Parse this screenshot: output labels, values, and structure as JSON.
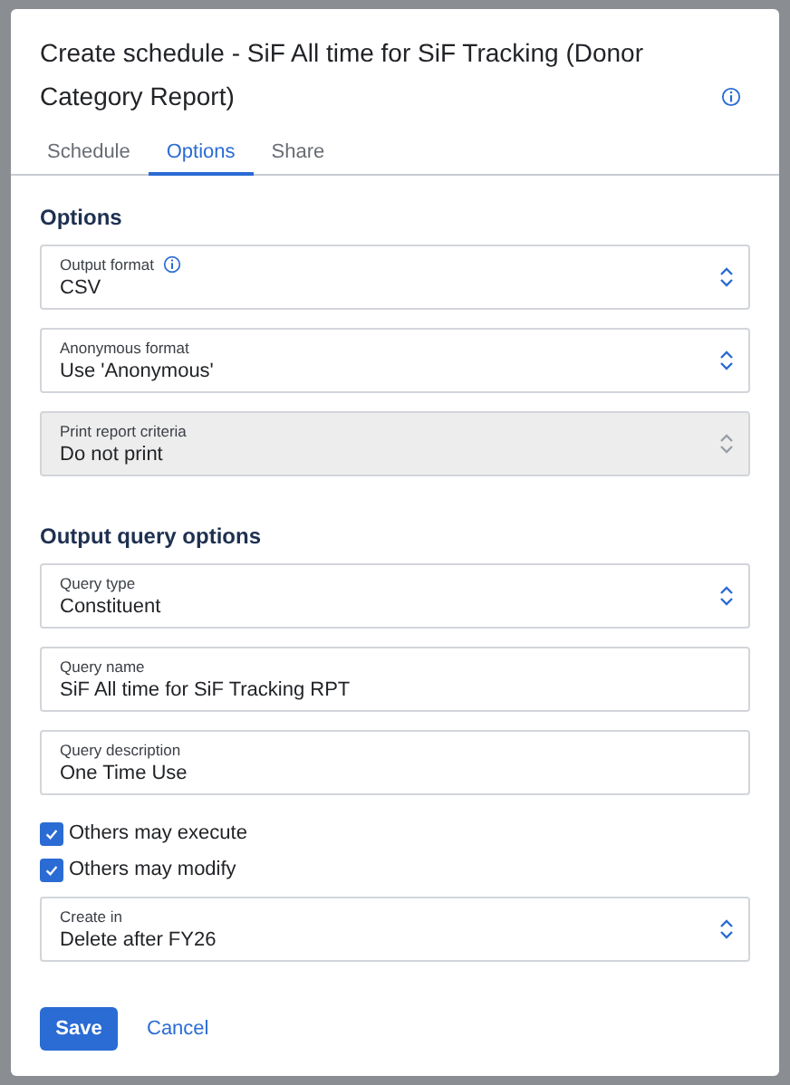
{
  "dialog": {
    "title": "Create schedule - SiF All time for SiF Tracking (Donor Category Report)"
  },
  "tabs": [
    {
      "label": "Schedule",
      "selected": false
    },
    {
      "label": "Options",
      "selected": true
    },
    {
      "label": "Share",
      "selected": false
    }
  ],
  "sections": [
    {
      "heading": "Options",
      "items": [
        {
          "kind": "select",
          "label": "Output format",
          "info": true,
          "value": "CSV",
          "disabled": false
        },
        {
          "kind": "select",
          "label": "Anonymous format",
          "value": "Use 'Anonymous'",
          "disabled": false
        },
        {
          "kind": "select",
          "label": "Print report criteria",
          "value": "Do not print",
          "disabled": true
        }
      ]
    },
    {
      "heading": "Output query options",
      "items": [
        {
          "kind": "select",
          "label": "Query type",
          "value": "Constituent",
          "disabled": false
        },
        {
          "kind": "text",
          "label": "Query name",
          "value": "SiF All time for SiF Tracking RPT"
        },
        {
          "kind": "text",
          "label": "Query description",
          "value": "One Time Use"
        },
        {
          "kind": "checkbox",
          "label": "Others may execute",
          "checked": true
        },
        {
          "kind": "checkbox",
          "label": "Others may modify",
          "checked": true
        },
        {
          "kind": "select",
          "label": "Create in",
          "value": "Delete after FY26",
          "disabled": false
        }
      ]
    }
  ],
  "buttons": {
    "save": "Save",
    "cancel": "Cancel"
  }
}
